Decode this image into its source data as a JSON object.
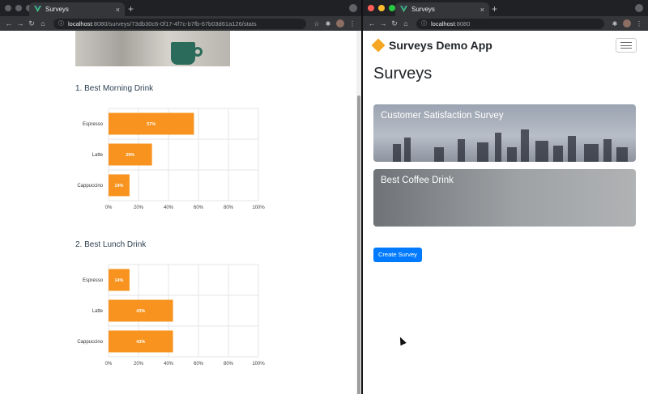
{
  "left_window": {
    "tab": {
      "title": "Surveys",
      "close": "×",
      "new_tab": "+"
    },
    "url": {
      "host": "localhost",
      "path": ":8080/surveys/73db30c6-0f17-4f7c-b7fb-67b03d61a126/stats"
    }
  },
  "right_window": {
    "tab": {
      "title": "Surveys",
      "close": "×",
      "new_tab": "+"
    },
    "url": {
      "host": "localhost",
      "path": ":8080"
    }
  },
  "icons": {
    "back": "←",
    "forward": "→",
    "reload": "↻",
    "home": "⌂",
    "info": "ⓘ",
    "star": "☆",
    "extensions": "✱",
    "menu": "⋮"
  },
  "colors": {
    "bar": "#f7931e",
    "primary": "#007bff",
    "brand": "#f5a623",
    "window_red": "#ff5f57",
    "window_yellow": "#febc2e",
    "window_green": "#28c840"
  },
  "stats": {
    "questions": [
      {
        "title": "1. Best Morning Drink"
      },
      {
        "title": "2. Best Lunch Drink"
      }
    ]
  },
  "chart_data": [
    {
      "type": "bar",
      "orientation": "horizontal",
      "categories": [
        "Espresso",
        "Latte",
        "Cappuccino"
      ],
      "values": [
        57,
        29,
        14
      ],
      "data_labels": [
        "57%",
        "29%",
        "14%"
      ],
      "x_ticks": [
        "0%",
        "20%",
        "40%",
        "60%",
        "80%",
        "100%"
      ],
      "xlim": [
        0,
        100
      ],
      "grid": true
    },
    {
      "type": "bar",
      "orientation": "horizontal",
      "categories": [
        "Espresso",
        "Latte",
        "Cappuccino"
      ],
      "values": [
        14,
        43,
        43
      ],
      "data_labels": [
        "14%",
        "43%",
        "43%"
      ],
      "x_ticks": [
        "0%",
        "20%",
        "40%",
        "60%",
        "80%",
        "100%"
      ],
      "xlim": [
        0,
        100
      ],
      "grid": true
    }
  ],
  "app": {
    "brand": "Surveys Demo App",
    "heading": "Surveys",
    "cards": [
      {
        "title": "Customer Satisfaction Survey"
      },
      {
        "title": "Best Coffee Drink"
      }
    ],
    "create_button": "Create Survey"
  }
}
